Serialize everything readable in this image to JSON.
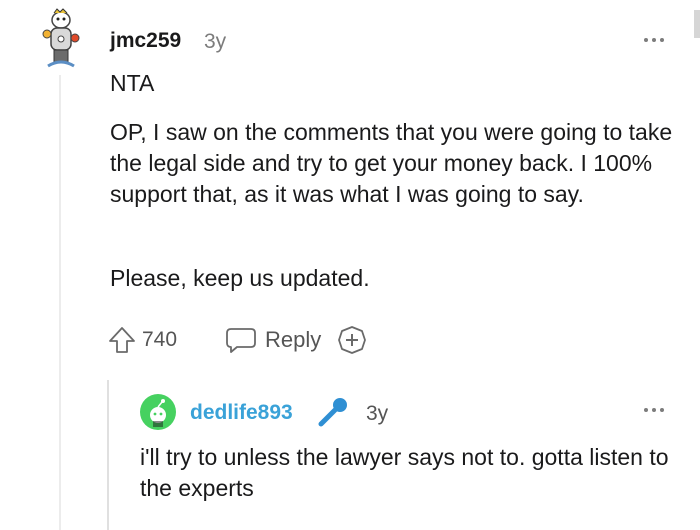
{
  "comment": {
    "username": "jmc259",
    "age": "3y",
    "paragraphs": [
      "NTA",
      "OP, I saw on the comments that you were going to take the legal side and try to get your money back. I 100% support that, as it was what I was going to say.",
      "Please, keep us updated."
    ],
    "score": "740",
    "reply_label": "Reply"
  },
  "reply": {
    "username": "dedlife893",
    "age": "3y",
    "text": "i'll try to unless the lawyer says not to. gotta listen to the experts"
  },
  "colors": {
    "reply_username": "#3aa2d8",
    "muted_text": "#7c7c7c",
    "avatar_green": "#46d160",
    "mic_blue": "#2f8fd3"
  },
  "icons": {
    "upvote": "upvote-arrow-icon",
    "reply": "speech-bubble-icon",
    "award": "plus-circle-icon",
    "more": "ellipsis-icon",
    "mic": "microphone-icon"
  }
}
